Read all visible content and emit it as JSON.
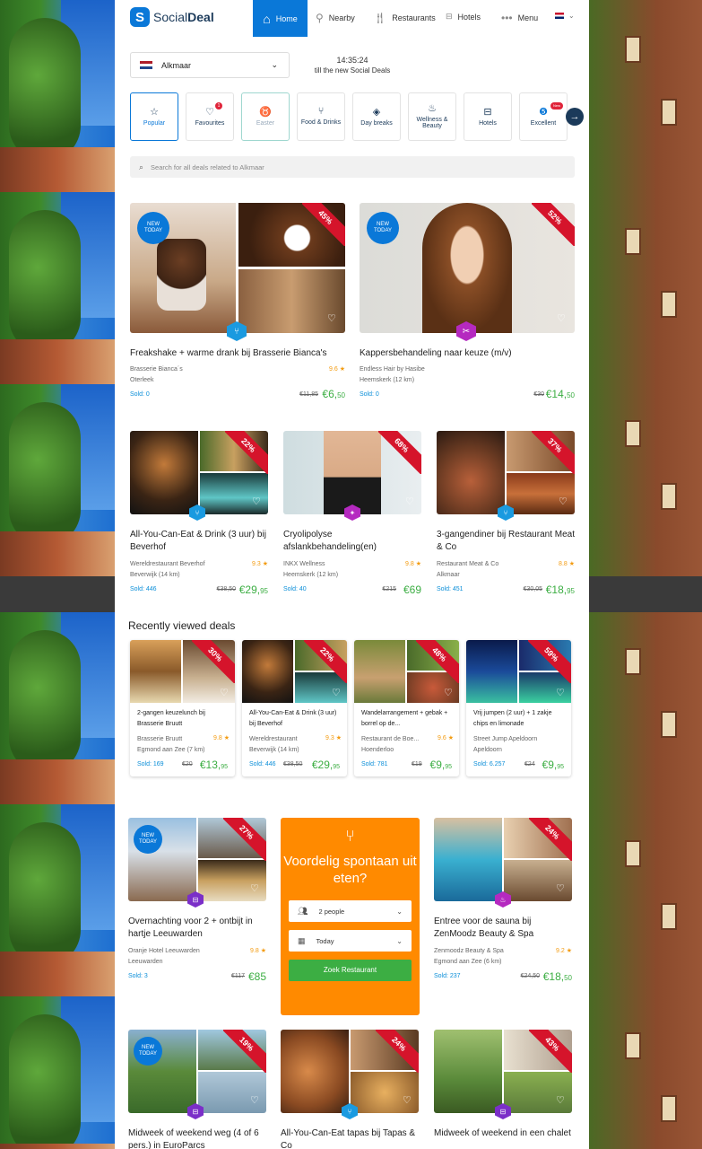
{
  "brand": {
    "name_plain": "Social",
    "name_bold": "Deal"
  },
  "nav": {
    "home": "Home",
    "nearby": "Nearby",
    "restaurants": "Restaurants",
    "hotels": "Hotels",
    "menu": "Menu"
  },
  "location": {
    "city": "Alkmaar"
  },
  "countdown": {
    "time": "14:35:24",
    "caption": "till the new Social Deals"
  },
  "categories": [
    {
      "label": "Popular"
    },
    {
      "label": "Favourites",
      "badge": "1"
    },
    {
      "label": "Easter"
    },
    {
      "label": "Food & Drinks"
    },
    {
      "label": "Day breaks"
    },
    {
      "label": "Wellness & Beauty"
    },
    {
      "label": "Hotels"
    },
    {
      "label": "Excellent",
      "badge": "New"
    }
  ],
  "search": {
    "placeholder": "Search for all deals related to Alkmaar"
  },
  "badges": {
    "new_today_1": "NEW",
    "new_today_2": "TODAY"
  },
  "deals_large": [
    {
      "discount": "45%",
      "title": "Freakshake + warme drank bij Brasserie Bianca's",
      "vendor": "Brasserie Bianca´s",
      "location": "Oterleek",
      "rating": "9.6 ★",
      "sold": "Sold: 0",
      "old_price": "€11,85",
      "price_main": "€6,",
      "price_cents": "50"
    },
    {
      "discount": "52%",
      "title": "Kappersbehandeling naar keuze (m/v)",
      "vendor": "Endless Hair by Hasibe",
      "location": "Heemskerk (12 km)",
      "rating": "",
      "sold": "Sold: 0",
      "old_price": "€30",
      "price_main": "€14,",
      "price_cents": "50"
    }
  ],
  "deals_row2": [
    {
      "discount": "22%",
      "title": "All-You-Can-Eat & Drink (3 uur) bij Beverhof",
      "vendor": "Wereldrestaurant Beverhof",
      "location": "Beverwijk (14 km)",
      "rating": "9.3 ★",
      "sold": "Sold: 446",
      "old_price": "€38,50",
      "price_main": "€29,",
      "price_cents": "95"
    },
    {
      "discount": "68%",
      "title": "Cryolipolyse afslankbehandeling(en)",
      "vendor": "INKX Wellness",
      "location": "Heemskerk (12 km)",
      "rating": "9.8 ★",
      "sold": "Sold: 40",
      "old_price": "€215",
      "price_main": "€69",
      "price_cents": ""
    },
    {
      "discount": "37%",
      "title": "3-gangendiner bij Restaurant Meat & Co",
      "vendor": "Restaurant Meat & Co",
      "location": "Alkmaar",
      "rating": "8.8 ★",
      "sold": "Sold: 451",
      "old_price": "€30,05",
      "price_main": "€18,",
      "price_cents": "95"
    }
  ],
  "recent": {
    "title": "Recently viewed deals",
    "items": [
      {
        "discount": "30%",
        "title": "2-gangen keuzelunch bij Brasserie Bruutt",
        "vendor": "Brasserie Bruutt",
        "location": "Egmond aan Zee (7 km)",
        "rating": "9.8 ★",
        "sold": "Sold: 169",
        "old_price": "€20",
        "price_main": "€13,",
        "price_cents": "95"
      },
      {
        "discount": "22%",
        "title": "All-You-Can-Eat & Drink (3 uur) bij Beverhof",
        "vendor": "Wereldrestaurant",
        "location": "Beverwijk (14 km)",
        "rating": "9.3 ★",
        "sold": "Sold: 446",
        "old_price": "€38,50",
        "price_main": "€29,",
        "price_cents": "95"
      },
      {
        "discount": "48%",
        "title": "Wandelarrangement + gebak + borrel op de...",
        "vendor": "Restaurant de Boe...",
        "location": "Hoenderloo",
        "rating": "9.6 ★",
        "sold": "Sold: 781",
        "old_price": "€19",
        "price_main": "€9,",
        "price_cents": "95"
      },
      {
        "discount": "59%",
        "title": "Vrij jumpen (2 uur) + 1 zakje chips en limonade",
        "vendor": "Street Jump Apeldoorn",
        "location": "Apeldoorn",
        "rating": "",
        "sold": "Sold: 6.257",
        "old_price": "€24",
        "price_main": "€9,",
        "price_cents": "95"
      }
    ]
  },
  "deals_row3": [
    {
      "discount": "27%",
      "title": "Overnachting voor 2 + ontbijt in hartje Leeuwarden",
      "vendor": "Oranje Hotel Leeuwarden",
      "location": "Leeuwarden",
      "rating": "9.8 ★",
      "sold": "Sold: 3",
      "old_price": "€117",
      "price_main": "€85",
      "price_cents": ""
    },
    {
      "discount": "24%",
      "title": "Entree voor de sauna bij ZenMoodz Beauty & Spa",
      "vendor": "Zenmoodz Beauty & Spa",
      "location": "Egmond aan Zee (6 km)",
      "rating": "9.2 ★",
      "sold": "Sold: 237",
      "old_price": "€24,50",
      "price_main": "€18,",
      "price_cents": "50"
    }
  ],
  "promo": {
    "title": "Voordelig spontaan uit eten?",
    "people": "2 people",
    "date": "Today",
    "button": "Zoek Restaurant"
  },
  "deals_row4": [
    {
      "discount": "19%",
      "title": "Midweek of weekend weg (4 of 6 pers.) in EuroParcs"
    },
    {
      "discount": "24%",
      "title": "All-You-Can-Eat tapas bij Tapas & Co"
    },
    {
      "discount": "43%",
      "title": "Midweek of weekend in een chalet"
    }
  ],
  "colors": {
    "brand_blue": "#0a78d8",
    "price_green": "#3cae43",
    "discount_red": "#d5142b",
    "promo_orange": "#ff8a00",
    "rating_orange": "#f39c12"
  }
}
